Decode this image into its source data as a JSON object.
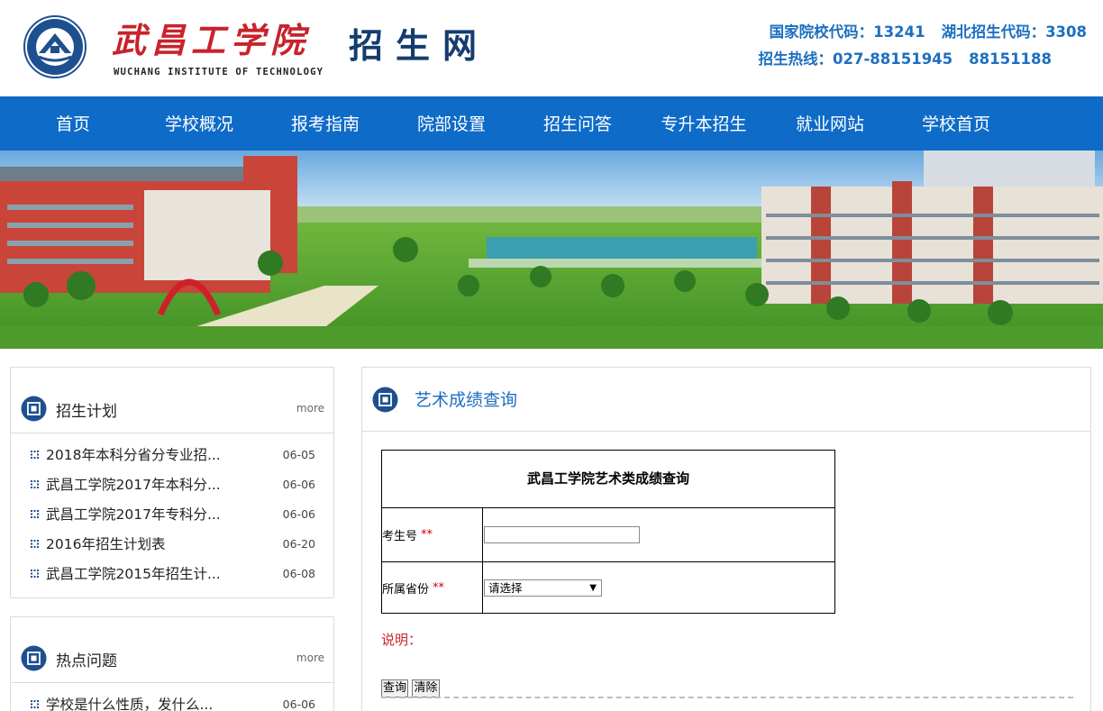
{
  "header": {
    "logo_cn": "武昌工学院",
    "logo_en": "WUCHANG INSTITUTE OF TECHNOLOGY",
    "site_name": "招生网",
    "school_code": "国家院校代码：13241",
    "hubei_code": "湖北招生代码：3308",
    "hotline": "招生热线：027-88151945",
    "hotline2": "88151188"
  },
  "nav": {
    "items": [
      {
        "label": "首页"
      },
      {
        "label": "学校概况"
      },
      {
        "label": "报考指南"
      },
      {
        "label": "院部设置"
      },
      {
        "label": "招生问答"
      },
      {
        "label": "专升本招生"
      },
      {
        "label": "就业网站"
      },
      {
        "label": "学校首页"
      }
    ]
  },
  "plan_panel": {
    "title": "招生计划",
    "more": "more",
    "items": [
      {
        "title": "2018年本科分省分专业招...",
        "date": "06-05"
      },
      {
        "title": "武昌工学院2017年本科分...",
        "date": "06-06"
      },
      {
        "title": "武昌工学院2017年专科分...",
        "date": "06-06"
      },
      {
        "title": "2016年招生计划表",
        "date": "06-20"
      },
      {
        "title": "武昌工学院2015年招生计...",
        "date": "06-08"
      }
    ]
  },
  "hot_panel": {
    "title": "热点问题",
    "more": "more",
    "items": [
      {
        "title": "学校是什么性质，发什么...",
        "date": "06-06"
      }
    ]
  },
  "main": {
    "title": "艺术成绩查询",
    "form_title": "武昌工学院艺术类成绩查询",
    "field_id_label": "考生号",
    "field_province_label": "所属省份",
    "required_mark": "**",
    "province_selected": "请选择",
    "note_label": "说明：",
    "query_button": "查询",
    "clear_button": "清除"
  },
  "colors": {
    "nav_bg": "#0f6bc8",
    "brand_red": "#c8232c",
    "brand_blue": "#1d6fc0",
    "site_name": "#143c6e"
  }
}
